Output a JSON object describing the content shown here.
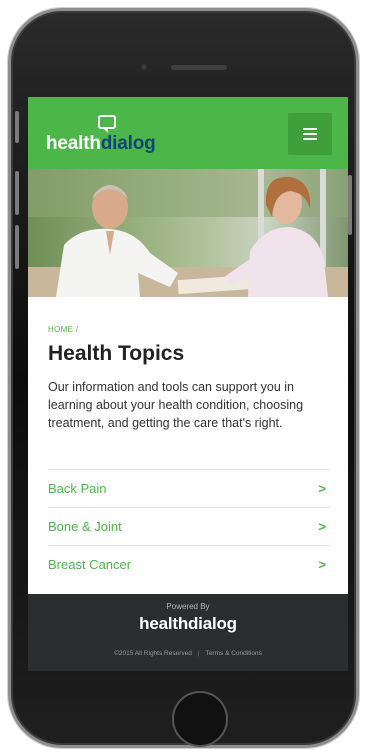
{
  "header": {
    "logo_part_1": "health",
    "logo_part_2": "dialog",
    "menu_icon": "hamburger-icon"
  },
  "hero": {
    "image": "doctor-and-patient-photo"
  },
  "breadcrumb": {
    "home": "HOME",
    "separator": "/"
  },
  "page": {
    "title": "Health Topics",
    "intro": "Our information and tools can support you in learning about your health condition, choosing treatment, and getting the care that's right."
  },
  "topics": [
    {
      "label": "Back Pain",
      "chevron": ">"
    },
    {
      "label": "Bone & Joint",
      "chevron": ">"
    },
    {
      "label": "Breast Cancer",
      "chevron": ">"
    }
  ],
  "footer": {
    "powered_by": "Powered By",
    "logo": "healthdialog",
    "copyright": "©2015 All Rights Reserved",
    "separator": "|",
    "terms": "Terms & Conditions"
  },
  "colors": {
    "brand_green": "#4cb648",
    "logo_blue": "#11447a",
    "footer_bg": "#2b2d2f"
  }
}
